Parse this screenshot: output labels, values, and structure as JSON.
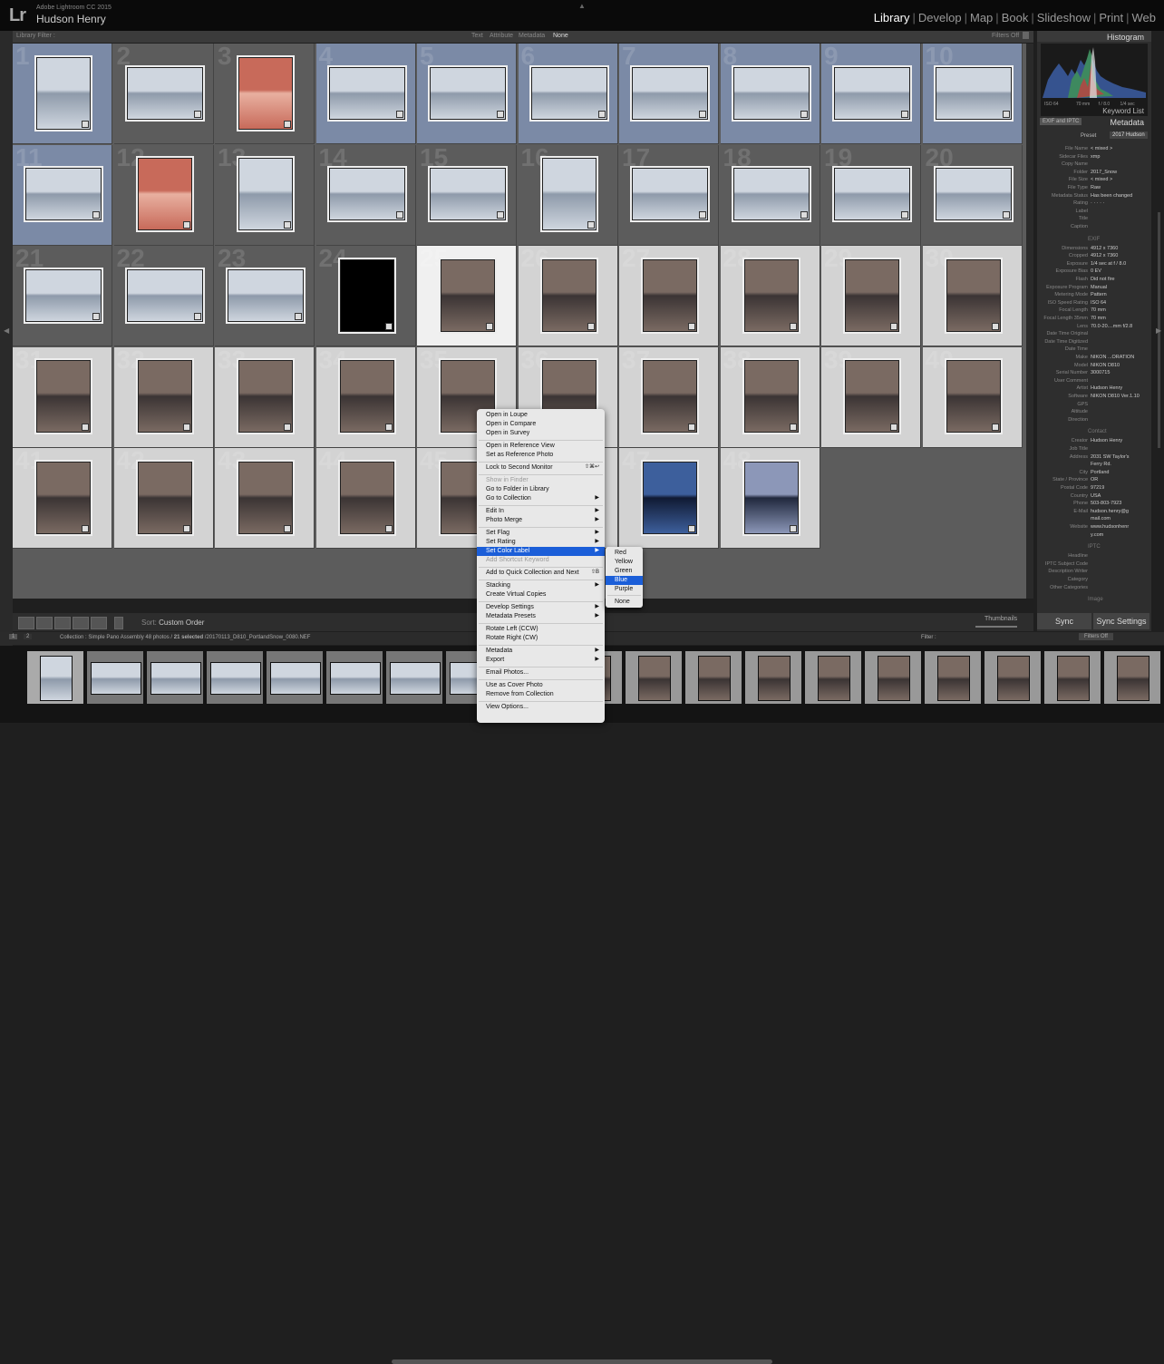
{
  "app": {
    "product": "Adobe Lightroom CC 2015",
    "user": "Hudson Henry"
  },
  "modules": [
    "Library",
    "Develop",
    "Map",
    "Book",
    "Slideshow",
    "Print",
    "Web"
  ],
  "active_module": "Library",
  "filter_bar": {
    "title": "Library Filter :",
    "options": [
      "Text",
      "Attribute",
      "Metadata",
      "None"
    ],
    "filters": "Filters Off"
  },
  "grid_numbers": [
    "1",
    "2",
    "3",
    "4",
    "5",
    "6",
    "7",
    "8",
    "9",
    "10",
    "11",
    "12",
    "13",
    "14",
    "15",
    "16",
    "17",
    "18",
    "19",
    "20",
    "21",
    "22",
    "23",
    "24",
    "25",
    "26",
    "27",
    "28",
    "29",
    "30",
    "31",
    "32",
    "33",
    "34",
    "35",
    "36",
    "37",
    "38",
    "39",
    "40",
    "41",
    "42",
    "43",
    "44",
    "45",
    "46",
    "47",
    "48"
  ],
  "toolbar": {
    "sort_label": "Sort:",
    "sort_value": "Custom Order",
    "thumbnails": "Thumbnails"
  },
  "right_panel": {
    "histogram_title": "Histogram",
    "histogram_info": [
      "ISO 64",
      "70 mm",
      "f / 8.0",
      "1/4 sec"
    ],
    "keyword_list": "Keyword List",
    "metadata_title": "Metadata",
    "metadata_select": "EXIF and IPTC",
    "preset_label": "Preset",
    "preset_value": "2017 Hudson",
    "rows_basic": [
      [
        "File Name",
        "< mixed >"
      ],
      [
        "Sidecar Files",
        "xmp"
      ],
      [
        "Copy Name",
        ""
      ],
      [
        "Folder",
        "2017_Snow"
      ],
      [
        "File Size",
        "< mixed >"
      ],
      [
        "File Type",
        "Raw"
      ],
      [
        "Metadata Status",
        "Has been changed"
      ],
      [
        "Rating",
        "· · · · ·"
      ],
      [
        "Label",
        ""
      ],
      [
        "Title",
        ""
      ],
      [
        "Caption",
        ""
      ]
    ],
    "exif_head": "EXIF",
    "rows_exif": [
      [
        "Dimensions",
        "4912 x 7360"
      ],
      [
        "Cropped",
        "4912 x 7360"
      ],
      [
        "Exposure",
        "1/4 sec at f / 8.0"
      ],
      [
        "Exposure Bias",
        "0 EV"
      ],
      [
        "Flash",
        "Did not fire"
      ],
      [
        "Exposure Program",
        "Manual"
      ],
      [
        "Metering Mode",
        "Pattern"
      ],
      [
        "ISO Speed Rating",
        "ISO 64"
      ],
      [
        "Focal Length",
        "70 mm"
      ],
      [
        "Focal Length 35mm",
        "70 mm"
      ],
      [
        "Lens",
        "70.0-20....mm f/2.8"
      ],
      [
        "Date Time Original",
        ""
      ],
      [
        "Date Time Digitized",
        ""
      ],
      [
        "Date Time",
        ""
      ],
      [
        "Make",
        "NIKON ...ORATION"
      ],
      [
        "Model",
        "NIKON D810"
      ],
      [
        "Serial Number",
        "3000715"
      ],
      [
        "User Comment",
        ""
      ],
      [
        "Artist",
        "Hudson Henry"
      ],
      [
        "Software",
        "NIKON D810 Ver.1.10"
      ],
      [
        "GPS",
        ""
      ],
      [
        "Altitude",
        ""
      ],
      [
        "Direction",
        ""
      ]
    ],
    "contact_head": "Contact",
    "rows_contact": [
      [
        "Creator",
        "Hudson Henry"
      ],
      [
        "Job Title",
        ""
      ],
      [
        "Address",
        "2031 SW Taylor's"
      ],
      [
        "",
        "Ferry Rd."
      ],
      [
        "City",
        "Portland"
      ],
      [
        "State / Province",
        "OR"
      ],
      [
        "Postal Code",
        "97219"
      ],
      [
        "Country",
        "USA"
      ],
      [
        "Phone",
        "503-803-7923"
      ],
      [
        "E-Mail",
        "hudson.henry@g"
      ],
      [
        "",
        "mail.com"
      ],
      [
        "Website",
        "www.hudsonhenr"
      ],
      [
        "",
        "y.com"
      ]
    ],
    "iptc_head": "IPTC",
    "rows_iptc": [
      [
        "Headline",
        ""
      ],
      [
        "IPTC Subject Code",
        ""
      ],
      [
        "Description Writer",
        ""
      ],
      [
        "Category",
        ""
      ],
      [
        "Other Categories",
        ""
      ]
    ],
    "image_head": "Image",
    "sync_metadata": "Sync Metadata",
    "sync_settings": "Sync Settings"
  },
  "filmstrip_header": {
    "pages": [
      "1",
      "2"
    ],
    "collection": "Collection : Simple Pano Assembly",
    "count": "48 photos /",
    "selected": "21 selected",
    "path": "/20170113_D810_PortlandSnow_0080.NEF",
    "filter_label": "Filter :",
    "filters_off": "Filters Off"
  },
  "context_menu": [
    {
      "label": "Open in Loupe"
    },
    {
      "label": "Open in Compare"
    },
    {
      "label": "Open in Survey"
    },
    {
      "sep": true
    },
    {
      "label": "Open in Reference View"
    },
    {
      "label": "Set as Reference Photo"
    },
    {
      "sep": true
    },
    {
      "label": "Lock to Second Monitor",
      "shortcut": "⇧⌘↩"
    },
    {
      "sep": true
    },
    {
      "label": "Show in Finder",
      "disabled": true
    },
    {
      "label": "Go to Folder in Library"
    },
    {
      "label": "Go to Collection",
      "sub": true
    },
    {
      "sep": true
    },
    {
      "label": "Edit In",
      "sub": true
    },
    {
      "label": "Photo Merge",
      "sub": true
    },
    {
      "sep": true
    },
    {
      "label": "Set Flag",
      "sub": true
    },
    {
      "label": "Set Rating",
      "sub": true
    },
    {
      "label": "Set Color Label",
      "sub": true,
      "highlight": true
    },
    {
      "label": "Add Shortcut Keyword",
      "disabled": true
    },
    {
      "sep": true
    },
    {
      "label": "Add to Quick Collection and Next",
      "shortcut": "⇧B"
    },
    {
      "sep": true
    },
    {
      "label": "Stacking",
      "sub": true
    },
    {
      "label": "Create Virtual Copies"
    },
    {
      "sep": true
    },
    {
      "label": "Develop Settings",
      "sub": true
    },
    {
      "label": "Metadata Presets",
      "sub": true
    },
    {
      "sep": true
    },
    {
      "label": "Rotate Left (CCW)"
    },
    {
      "label": "Rotate Right (CW)"
    },
    {
      "sep": true
    },
    {
      "label": "Metadata",
      "sub": true
    },
    {
      "label": "Export",
      "sub": true
    },
    {
      "sep": true
    },
    {
      "label": "Email Photos..."
    },
    {
      "sep": true
    },
    {
      "label": "Use as Cover Photo"
    },
    {
      "label": "Remove from Collection"
    },
    {
      "sep": true
    },
    {
      "label": "View Options..."
    }
  ],
  "color_label_submenu": [
    "Red",
    "Yellow",
    "Green",
    "Blue",
    "Purple",
    "None"
  ],
  "colors": {
    "selected_cell": "#7b8aa6",
    "grey_cell": "#5c5c5c",
    "light_cell": "#d3d3d3",
    "highlight": "#1b5ed8"
  }
}
